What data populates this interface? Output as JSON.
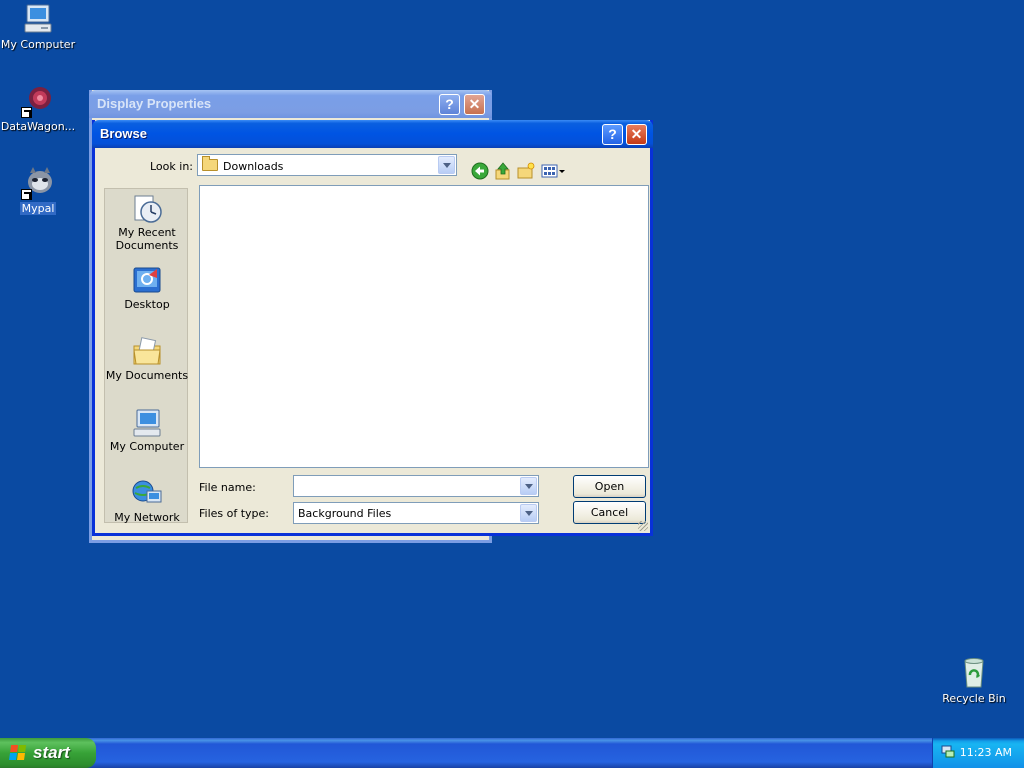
{
  "desktop": {
    "icons": [
      {
        "label": "My Computer"
      },
      {
        "label": "DataWagon..."
      },
      {
        "label": "Mypal"
      },
      {
        "label": "Recycle Bin"
      }
    ]
  },
  "display_properties": {
    "title": "Display Properties",
    "help_glyph": "?",
    "close_glyph": "✕"
  },
  "browse": {
    "title": "Browse",
    "help_glyph": "?",
    "close_glyph": "✕",
    "look_in_label": "Look in:",
    "look_in_value": "Downloads",
    "places": [
      {
        "label": "My Recent Documents"
      },
      {
        "label": "Desktop"
      },
      {
        "label": "My Documents"
      },
      {
        "label": "My Computer"
      },
      {
        "label": "My Network"
      }
    ],
    "file_name_label": "File name:",
    "file_name_value": "",
    "files_of_type_label": "Files of type:",
    "files_of_type_value": "Background Files",
    "open_label": "Open",
    "cancel_label": "Cancel"
  },
  "taskbar": {
    "start_label": "start",
    "clock": "11:23 AM"
  }
}
